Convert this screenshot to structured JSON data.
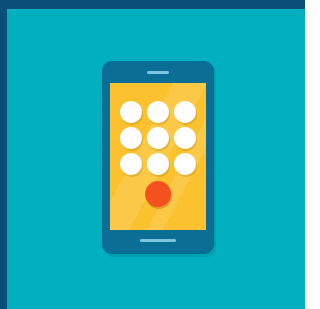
{
  "illustration": {
    "subject": "phone-keypad-illustration",
    "colors": {
      "frame": "#0a4f7a",
      "background": "#00b0bf",
      "phone_body": "#0a6e95",
      "screen": "#fbc12e",
      "keys": "#ffffff",
      "call_button": "#f4511e",
      "speaker": "#7cc6dd"
    },
    "keypad": {
      "rows": 3,
      "columns": 3,
      "key_count": 9
    }
  }
}
